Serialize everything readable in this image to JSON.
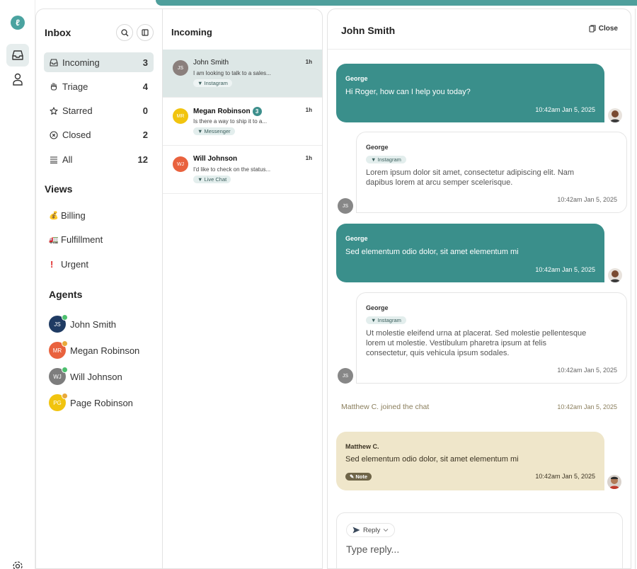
{
  "colors": {
    "accent": "#3a8f8b",
    "note_bg": "#efe6ca",
    "active_bg": "#e1e9e9"
  },
  "inbox": {
    "title": "Inbox",
    "nav": [
      {
        "label": "Incoming",
        "count": "3",
        "icon": "inbox-icon"
      },
      {
        "label": "Triage",
        "count": "4",
        "icon": "hand-icon"
      },
      {
        "label": "Starred",
        "count": "0",
        "icon": "star-icon"
      },
      {
        "label": "Closed",
        "count": "2",
        "icon": "close-circle-icon"
      },
      {
        "label": "All",
        "count": "12",
        "icon": "stack-icon"
      }
    ],
    "views_title": "Views",
    "views": [
      {
        "label": "Billing",
        "icon": "money-bag-icon"
      },
      {
        "label": "Fulfillment",
        "icon": "truck-icon"
      },
      {
        "label": "Urgent",
        "icon": "exclamation-icon"
      }
    ],
    "agents_title": "Agents",
    "agents": [
      {
        "name": "John Smith",
        "initials": "JS",
        "color": "#1f3b63",
        "status": "#4cbf6e"
      },
      {
        "name": "Megan Robinson",
        "initials": "MR",
        "color": "#e9623e",
        "status": "#e9a93a"
      },
      {
        "name": "Will Johnson",
        "initials": "WJ",
        "color": "#7d7d7d",
        "status": "#4cbf6e"
      },
      {
        "name": "Page Robinson",
        "initials": "PG",
        "color": "#f1c40f",
        "status": "#e9a93a"
      }
    ]
  },
  "conversations": {
    "title": "Incoming",
    "items": [
      {
        "name": "John Smith",
        "initials": "JS",
        "color": "#8a7f7c",
        "time": "1h",
        "snippet": "I am looking to talk to a sales...",
        "channel": "Instagram",
        "unread": ""
      },
      {
        "name": "Megan Robinson",
        "initials": "MR",
        "color": "#f1c40f",
        "time": "1h",
        "snippet": "Is there a way to ship it to a...",
        "channel": "Messenger",
        "unread": "3"
      },
      {
        "name": "Will Johnson",
        "initials": "WJ",
        "color": "#e9623e",
        "time": "1h",
        "snippet": "I'd like to check on the status...",
        "channel": "Live Chat",
        "unread": ""
      }
    ]
  },
  "chat": {
    "title": "John Smith",
    "close_label": "Close",
    "messages": [
      {
        "sender": "George",
        "text": "Hi Roger, how can I help you today?",
        "time": "10:42am Jan 5, 2025"
      },
      {
        "sender": "George",
        "channel": "Instagram",
        "text1": "Lorem ipsum dolor sit amet, consectetur adipiscing elit. Nam",
        "text2": "dapibus lorem at arcu semper scelerisque.",
        "time": "10:42am Jan 5, 2025",
        "avatar": "JS"
      },
      {
        "sender": "George",
        "text": "Sed elementum odio dolor, sit amet elementum mi",
        "time": "10:42am Jan 5, 2025"
      },
      {
        "sender": "George",
        "channel": "Instagram",
        "text1": "Ut molestie eleifend urna at placerat. Sed molestie pellentesque",
        "text2": "lorem ut molestie. Vestibulum pharetra ipsum at felis",
        "text3": "consectetur, quis vehicula ipsum sodales.",
        "time": "10:42am Jan 5, 2025",
        "avatar": "JS"
      }
    ],
    "system": {
      "text": "Matthew C. joined the chat",
      "time": "10:42am Jan 5, 2025"
    },
    "note": {
      "sender": "Matthew C.",
      "text": "Sed elementum odio dolor, sit amet elementum mi",
      "tag": "Note",
      "time": "10:42am Jan 5, 2025"
    },
    "composer": {
      "reply_label": "Reply",
      "placeholder": "Type reply..."
    }
  }
}
